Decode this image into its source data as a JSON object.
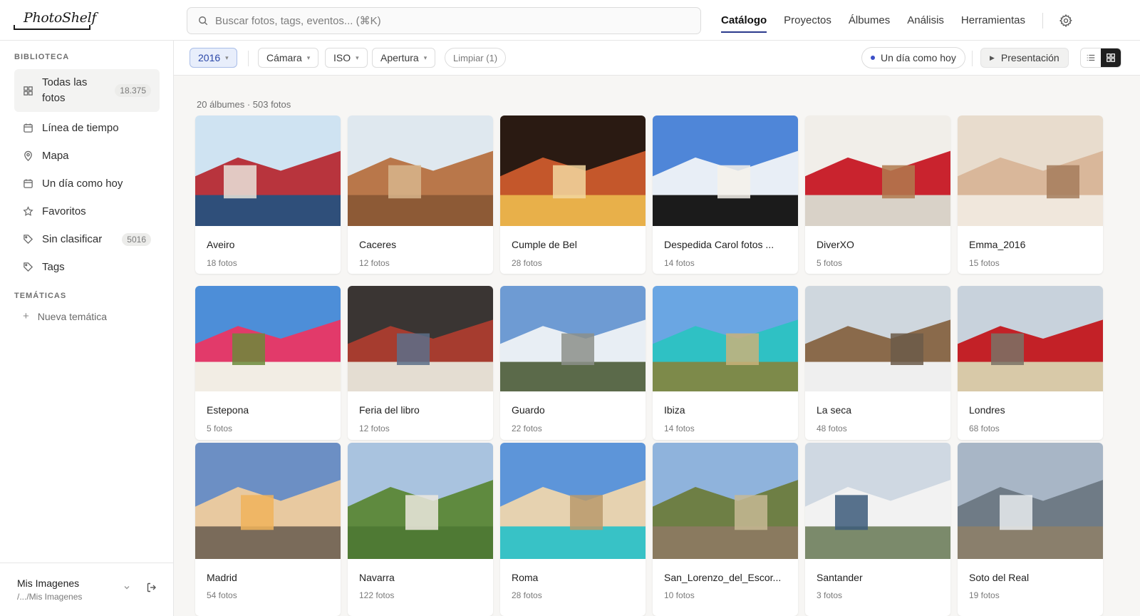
{
  "app": {
    "logo": "PhotoShelf"
  },
  "search": {
    "placeholder": "Buscar fotos, tags, eventos... (⌘K)"
  },
  "nav": {
    "items": [
      "Catálogo",
      "Proyectos",
      "Álbumes",
      "Análisis",
      "Herramientas"
    ],
    "active": "Catálogo"
  },
  "sidebar": {
    "library_title": "BIBLIOTECA",
    "items": [
      {
        "label": "Todas las fotos",
        "count": "18.375",
        "icon": "grid-icon",
        "active": true
      },
      {
        "label": "Línea de tiempo",
        "icon": "calendar-icon"
      },
      {
        "label": "Mapa",
        "icon": "map-pin-icon"
      },
      {
        "label": "Un día como hoy",
        "icon": "calendar-icon"
      },
      {
        "label": "Favoritos",
        "icon": "star-icon"
      },
      {
        "label": "Sin clasificar",
        "count": "5016",
        "icon": "tag-icon"
      },
      {
        "label": "Tags",
        "icon": "tag-icon"
      }
    ],
    "topics_title": "TEMÁTICAS",
    "new_topic": "Nueva temática",
    "footer": {
      "title": "Mis Imagenes",
      "path": "/.../Mis Imagenes"
    }
  },
  "filters": {
    "year": "2016",
    "camera": "Cámara",
    "iso": "ISO",
    "aperture": "Apertura",
    "clear": "Limpiar (1)",
    "on_this_day": "Un día como hoy",
    "presentation": "Presentación",
    "view_mode": "grid"
  },
  "content": {
    "summary": "20 álbumes · 503 fotos",
    "albums": [
      {
        "name": "Aveiro",
        "count": "18 fotos",
        "scene": "striped-houses"
      },
      {
        "name": "Caceres",
        "count": "12 fotos",
        "scene": "old-town"
      },
      {
        "name": "Cumple de Bel",
        "count": "28 fotos",
        "scene": "birthday-cake"
      },
      {
        "name": "Despedida Carol fotos ...",
        "count": "14 fotos",
        "scene": "beach-party"
      },
      {
        "name": "DiverXO",
        "count": "5 fotos",
        "scene": "restaurant-interior"
      },
      {
        "name": "Emma_2016",
        "count": "15 fotos",
        "scene": "portrait"
      },
      {
        "name": "Estepona",
        "count": "5 fotos",
        "scene": "flower-street"
      },
      {
        "name": "Feria del libro",
        "count": "12 fotos",
        "scene": "books"
      },
      {
        "name": "Guardo",
        "count": "22 fotos",
        "scene": "snowy-mountains"
      },
      {
        "name": "Ibiza",
        "count": "14 fotos",
        "scene": "turquoise-bay"
      },
      {
        "name": "La seca",
        "count": "48 fotos",
        "scene": "stone-houses"
      },
      {
        "name": "Londres",
        "count": "68 fotos",
        "scene": "red-buses"
      },
      {
        "name": "Madrid",
        "count": "54 fotos",
        "scene": "city-dome"
      },
      {
        "name": "Navarra",
        "count": "122 fotos",
        "scene": "green-valley"
      },
      {
        "name": "Roma",
        "count": "28 fotos",
        "scene": "fountain"
      },
      {
        "name": "San_Lorenzo_del_Escor...",
        "count": "10 fotos",
        "scene": "monastery"
      },
      {
        "name": "Santander",
        "count": "3 fotos",
        "scene": "coastal-town"
      },
      {
        "name": "Soto del Real",
        "count": "19 fotos",
        "scene": "mountain-chapel"
      }
    ]
  },
  "colors": {
    "accent": "#2b3a8c",
    "chip_active_bg": "#e8eefb",
    "content_bg": "#f7f6f4"
  }
}
